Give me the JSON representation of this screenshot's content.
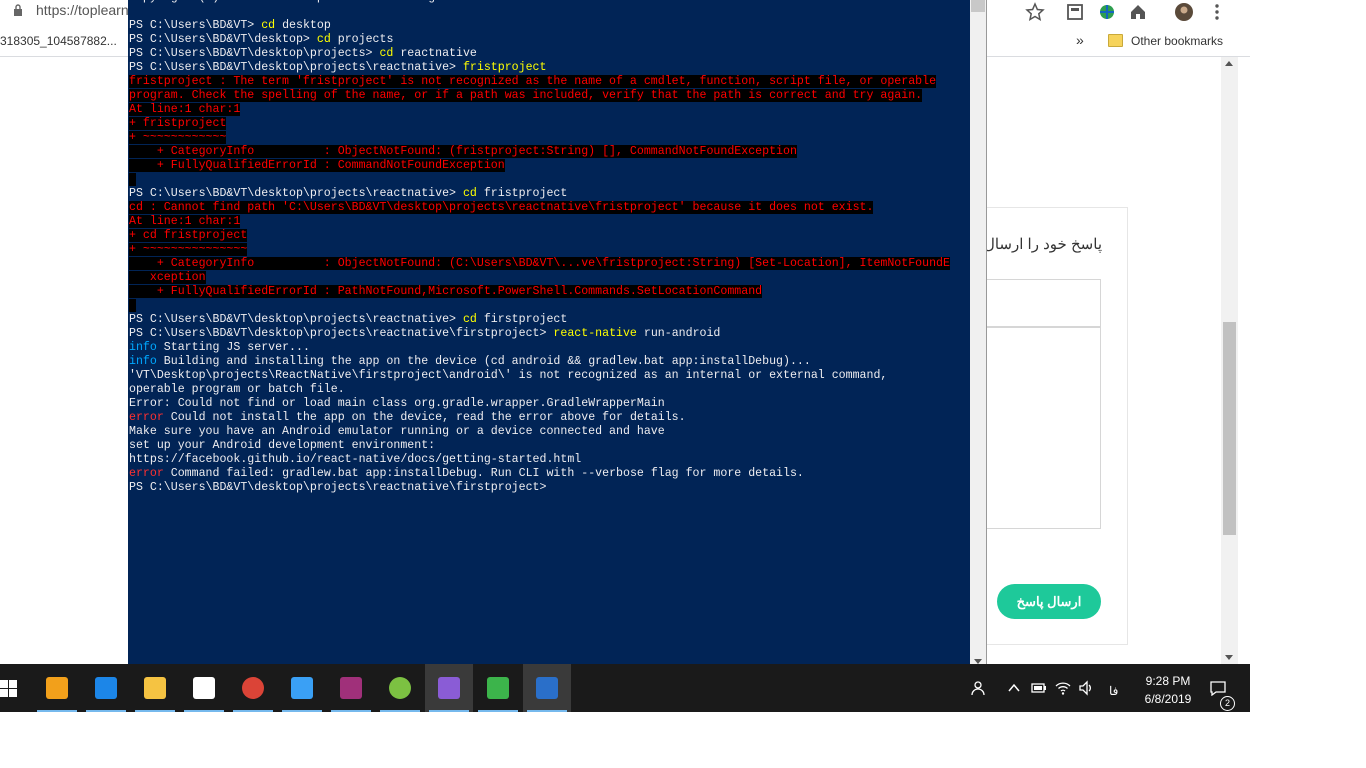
{
  "browser": {
    "url": "https://toplearn",
    "bookmarks": {
      "left_item": "318305_104587882...",
      "more": "»",
      "other": "Other bookmarks"
    }
  },
  "page": {
    "reply_title": "پاسخ خود را ارسال",
    "send_button": "ارسال پاسخ"
  },
  "terminal": {
    "lines": [
      {
        "segs": [
          {
            "t": "Copyright (C) Microsoft Corporation. All rights reserved.",
            "c": ""
          }
        ]
      },
      {
        "segs": [
          {
            "t": "",
            "c": ""
          }
        ]
      },
      {
        "segs": [
          {
            "t": "PS C:\\Users\\BD&VT> ",
            "c": ""
          },
          {
            "t": "cd",
            "c": "cmd"
          },
          {
            "t": " desktop",
            "c": ""
          }
        ]
      },
      {
        "segs": [
          {
            "t": "PS C:\\Users\\BD&VT\\desktop> ",
            "c": ""
          },
          {
            "t": "cd",
            "c": "cmd"
          },
          {
            "t": " projects",
            "c": ""
          }
        ]
      },
      {
        "segs": [
          {
            "t": "PS C:\\Users\\BD&VT\\desktop\\projects> ",
            "c": ""
          },
          {
            "t": "cd",
            "c": "cmd"
          },
          {
            "t": " reactnative",
            "c": ""
          }
        ]
      },
      {
        "segs": [
          {
            "t": "PS C:\\Users\\BD&VT\\desktop\\projects\\reactnative> ",
            "c": ""
          },
          {
            "t": "fristproject",
            "c": "cmd"
          }
        ]
      },
      {
        "segs": [
          {
            "t": "fristproject : The term 'fristproject' is not recognized as the name of a cmdlet, function, script file, or operable",
            "c": "err"
          }
        ]
      },
      {
        "segs": [
          {
            "t": "program. Check the spelling of the name, or if a path was included, verify that the path is correct and try again.",
            "c": "err"
          }
        ]
      },
      {
        "segs": [
          {
            "t": "At line:1 char:1",
            "c": "err"
          }
        ]
      },
      {
        "segs": [
          {
            "t": "+ fristproject",
            "c": "err"
          }
        ]
      },
      {
        "segs": [
          {
            "t": "+ ~~~~~~~~~~~~",
            "c": "err"
          }
        ]
      },
      {
        "segs": [
          {
            "t": "    + CategoryInfo          : ObjectNotFound: (fristproject:String) [], CommandNotFoundException",
            "c": "err"
          }
        ]
      },
      {
        "segs": [
          {
            "t": "    + FullyQualifiedErrorId : CommandNotFoundException",
            "c": "err"
          }
        ]
      },
      {
        "segs": [
          {
            "t": " ",
            "c": "err"
          }
        ]
      },
      {
        "segs": [
          {
            "t": "PS C:\\Users\\BD&VT\\desktop\\projects\\reactnative> ",
            "c": ""
          },
          {
            "t": "cd",
            "c": "cmd"
          },
          {
            "t": " fristproject",
            "c": ""
          }
        ]
      },
      {
        "segs": [
          {
            "t": "cd : Cannot find path 'C:\\Users\\BD&VT\\desktop\\projects\\reactnative\\fristproject' because it does not exist.",
            "c": "err"
          }
        ]
      },
      {
        "segs": [
          {
            "t": "At line:1 char:1",
            "c": "err"
          }
        ]
      },
      {
        "segs": [
          {
            "t": "+ cd fristproject",
            "c": "err"
          }
        ]
      },
      {
        "segs": [
          {
            "t": "+ ~~~~~~~~~~~~~~~",
            "c": "err"
          }
        ]
      },
      {
        "segs": [
          {
            "t": "    + CategoryInfo          : ObjectNotFound: (C:\\Users\\BD&VT\\...ve\\fristproject:String) [Set-Location], ItemNotFoundE",
            "c": "err"
          }
        ]
      },
      {
        "segs": [
          {
            "t": "   xception",
            "c": "err"
          }
        ]
      },
      {
        "segs": [
          {
            "t": "    + FullyQualifiedErrorId : PathNotFound,Microsoft.PowerShell.Commands.SetLocationCommand",
            "c": "err"
          }
        ]
      },
      {
        "segs": [
          {
            "t": " ",
            "c": "err"
          }
        ]
      },
      {
        "segs": [
          {
            "t": "PS C:\\Users\\BD&VT\\desktop\\projects\\reactnative> ",
            "c": ""
          },
          {
            "t": "cd",
            "c": "cmd"
          },
          {
            "t": " firstproject",
            "c": ""
          }
        ]
      },
      {
        "segs": [
          {
            "t": "PS C:\\Users\\BD&VT\\desktop\\projects\\reactnative\\firstproject> ",
            "c": ""
          },
          {
            "t": "react-native",
            "c": "cmd"
          },
          {
            "t": " run-android",
            "c": ""
          }
        ]
      },
      {
        "segs": [
          {
            "t": "info",
            "c": "info"
          },
          {
            "t": " Starting JS server...",
            "c": ""
          }
        ]
      },
      {
        "segs": [
          {
            "t": "info",
            "c": "info"
          },
          {
            "t": " Building and installing the app on the device (cd android && gradlew.bat app:installDebug)...",
            "c": ""
          }
        ]
      },
      {
        "segs": [
          {
            "t": "'VT\\Desktop\\projects\\ReactNative\\firstproject\\android\\' is not recognized as an internal or external command,",
            "c": ""
          }
        ]
      },
      {
        "segs": [
          {
            "t": "operable program or batch file.",
            "c": ""
          }
        ]
      },
      {
        "segs": [
          {
            "t": "Error: Could not find or load main class org.gradle.wrapper.GradleWrapperMain",
            "c": ""
          }
        ]
      },
      {
        "segs": [
          {
            "t": "error",
            "c": "errw"
          },
          {
            "t": " Could not install the app on the device, read the error above for details.",
            "c": ""
          }
        ]
      },
      {
        "segs": [
          {
            "t": "Make sure you have an Android emulator running or a device connected and have",
            "c": ""
          }
        ]
      },
      {
        "segs": [
          {
            "t": "set up your Android development environment:",
            "c": ""
          }
        ]
      },
      {
        "segs": [
          {
            "t": "https://facebook.github.io/react-native/docs/getting-started.html",
            "c": ""
          }
        ]
      },
      {
        "segs": [
          {
            "t": "error",
            "c": "errw"
          },
          {
            "t": " Command failed: gradlew.bat app:installDebug. Run CLI with --verbose flag for more details.",
            "c": ""
          }
        ]
      },
      {
        "segs": [
          {
            "t": "PS C:\\Users\\BD&VT\\desktop\\projects\\reactnative\\firstproject>",
            "c": ""
          }
        ]
      }
    ]
  },
  "taskbar": {
    "language": "فا",
    "time": "9:28 PM",
    "date": "6/8/2019",
    "notifications": "2",
    "apps": [
      {
        "name": "store-icon",
        "color": "#f2a01b"
      },
      {
        "name": "edge-icon",
        "color": "#1c86e8"
      },
      {
        "name": "file-explorer-icon",
        "color": "#f5c342"
      },
      {
        "name": "mail-icon",
        "color": "#ffffff"
      },
      {
        "name": "chrome-icon",
        "color": "#db4437"
      },
      {
        "name": "edge-canary-icon",
        "color": "#3aa0f5"
      },
      {
        "name": "winrar-icon",
        "color": "#a0307a"
      },
      {
        "name": "android-studio-icon",
        "color": "#7cc142"
      },
      {
        "name": "visual-studio-icon",
        "color": "#8a5cd6"
      },
      {
        "name": "notepad-icon",
        "color": "#3cb44b"
      },
      {
        "name": "powershell-icon",
        "color": "#2a6fc9"
      }
    ]
  },
  "colors": {
    "terminal_bg": "#012456",
    "accent": "#1ec99a"
  }
}
